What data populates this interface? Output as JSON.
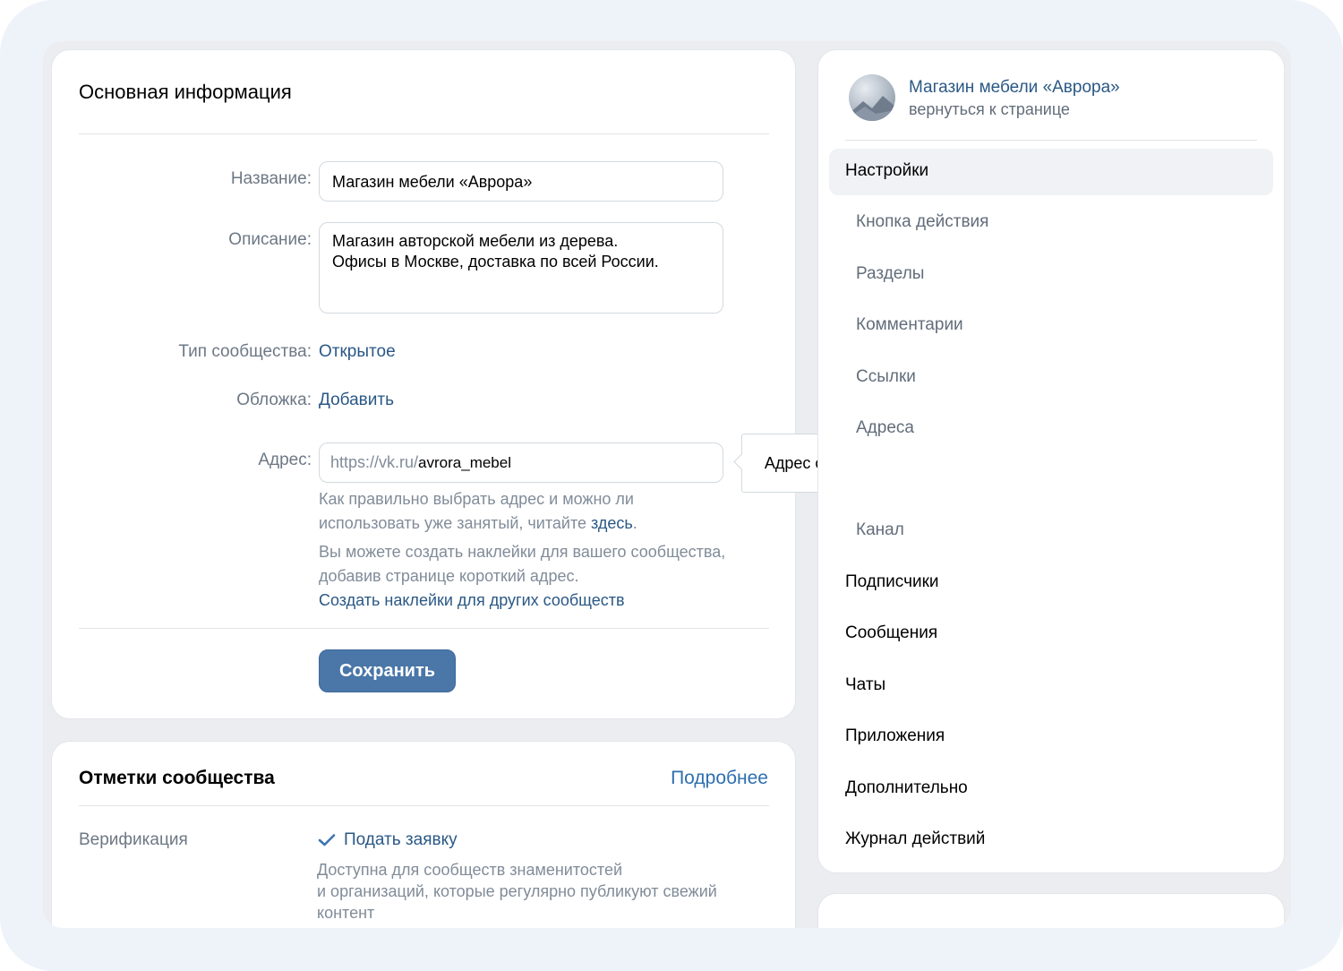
{
  "main_info": {
    "title": "Основная информация",
    "name_label": "Название:",
    "name_value": "Магазин мебели «Аврора»",
    "desc_label": "Описание:",
    "desc_line1": "Магазин авторской мебели из дерева.",
    "desc_line2": "Офисы в Москве, доставка по всей России.",
    "type_label": "Тип сообщества:",
    "type_value": "Открытое",
    "cover_label": "Обложка:",
    "cover_value": "Добавить",
    "address_label": "Адрес:",
    "address_prefix": "https://vk.ru/",
    "address_value": "avrora_mebel",
    "tooltip": "Адрес свободен",
    "hint1_line1": "Как правильно выбрать адрес и можно ли",
    "hint1_line2": "использовать уже занятый, читайте ",
    "hint1_link": "здесь",
    "hint1_end": ".",
    "hint2_line1": "Вы можете создать наклейки для вашего сообщества,",
    "hint2_line2": "добавив странице короткий адрес.",
    "stickers_link": "Создать наклейки для других сообществ",
    "save_button": "Сохранить"
  },
  "marks": {
    "title": "Отметки сообщества",
    "more_link": "Подробнее",
    "verification_label": "Верификация",
    "apply_link": "Подать заявку",
    "desc_line1": "Доступна для сообществ знаменитостей",
    "desc_line2": "и организаций, которые регулярно публикуют свежий",
    "desc_line3": "контент"
  },
  "sidebar": {
    "community_name": "Магазин мебели «Аврора»",
    "back_link": "вернуться к странице",
    "items": [
      {
        "label": "Настройки"
      },
      {
        "label": "Кнопка действия"
      },
      {
        "label": "Разделы"
      },
      {
        "label": "Комментарии"
      },
      {
        "label": "Ссылки"
      },
      {
        "label": "Адреса"
      },
      {
        "label": "Канал"
      },
      {
        "label": "Подписчики"
      },
      {
        "label": "Сообщения"
      },
      {
        "label": "Чаты"
      },
      {
        "label": "Приложения"
      },
      {
        "label": "Дополнительно"
      },
      {
        "label": "Журнал действий"
      }
    ]
  },
  "colors": {
    "accent": "#4a76a8",
    "link": "#2a5885",
    "secondary_text": "#818c99"
  }
}
